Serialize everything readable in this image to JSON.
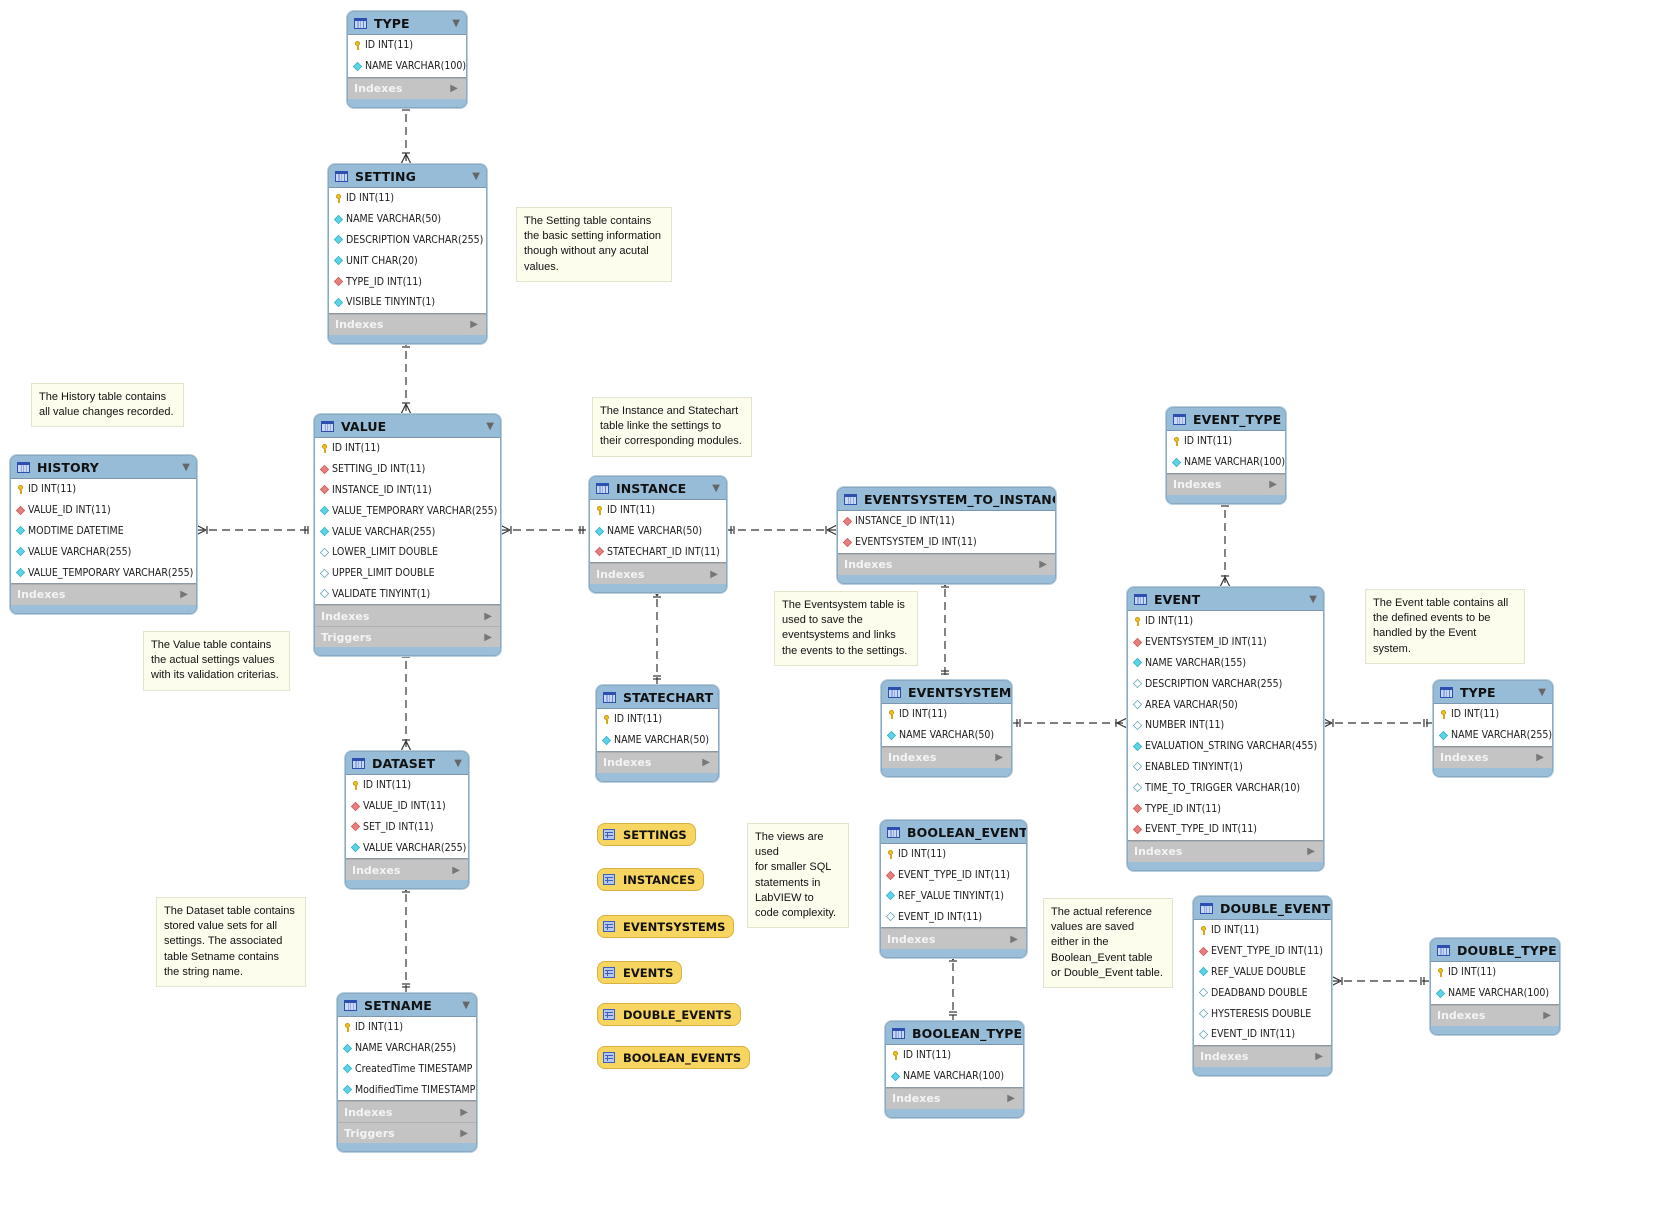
{
  "diagram": {
    "section_labels": {
      "indexes": "Indexes",
      "triggers": "Triggers"
    },
    "tables": [
      {
        "id": "type_top",
        "name": "TYPE",
        "columns": [
          {
            "text": "ID INT(11)",
            "kind": "pk"
          },
          {
            "text": "NAME VARCHAR(100)",
            "kind": "nn"
          }
        ],
        "sections": [
          "indexes"
        ]
      },
      {
        "id": "setting",
        "name": "SETTING",
        "columns": [
          {
            "text": "ID INT(11)",
            "kind": "pk"
          },
          {
            "text": "NAME VARCHAR(50)",
            "kind": "nn"
          },
          {
            "text": "DESCRIPTION VARCHAR(255)",
            "kind": "nn"
          },
          {
            "text": "UNIT CHAR(20)",
            "kind": "nn"
          },
          {
            "text": "TYPE_ID INT(11)",
            "kind": "fk"
          },
          {
            "text": "VISIBLE TINYINT(1)",
            "kind": "nn"
          }
        ],
        "sections": [
          "indexes"
        ]
      },
      {
        "id": "history",
        "name": "HISTORY",
        "columns": [
          {
            "text": "ID INT(11)",
            "kind": "pk"
          },
          {
            "text": "VALUE_ID INT(11)",
            "kind": "fk"
          },
          {
            "text": "MODTIME DATETIME",
            "kind": "nn"
          },
          {
            "text": "VALUE VARCHAR(255)",
            "kind": "nn"
          },
          {
            "text": "VALUE_TEMPORARY VARCHAR(255)",
            "kind": "nn"
          }
        ],
        "sections": [
          "indexes"
        ]
      },
      {
        "id": "value",
        "name": "VALUE",
        "columns": [
          {
            "text": "ID INT(11)",
            "kind": "pk"
          },
          {
            "text": "SETTING_ID INT(11)",
            "kind": "fk"
          },
          {
            "text": "INSTANCE_ID INT(11)",
            "kind": "fk"
          },
          {
            "text": "VALUE_TEMPORARY VARCHAR(255)",
            "kind": "nn"
          },
          {
            "text": "VALUE VARCHAR(255)",
            "kind": "nn"
          },
          {
            "text": "LOWER_LIMIT DOUBLE",
            "kind": "nl"
          },
          {
            "text": "UPPER_LIMIT DOUBLE",
            "kind": "nl"
          },
          {
            "text": "VALIDATE TINYINT(1)",
            "kind": "nl"
          }
        ],
        "sections": [
          "indexes",
          "triggers"
        ]
      },
      {
        "id": "instance",
        "name": "INSTANCE",
        "columns": [
          {
            "text": "ID INT(11)",
            "kind": "pk"
          },
          {
            "text": "NAME VARCHAR(50)",
            "kind": "nn"
          },
          {
            "text": "STATECHART_ID INT(11)",
            "kind": "fk"
          }
        ],
        "sections": [
          "indexes"
        ]
      },
      {
        "id": "es_to_instance",
        "name": "EVENTSYSTEM_TO_INSTANCE",
        "columns": [
          {
            "text": "INSTANCE_ID INT(11)",
            "kind": "fk"
          },
          {
            "text": "EVENTSYSTEM_ID INT(11)",
            "kind": "fk"
          }
        ],
        "sections": [
          "indexes"
        ]
      },
      {
        "id": "event_type",
        "name": "EVENT_TYPE",
        "columns": [
          {
            "text": "ID INT(11)",
            "kind": "pk"
          },
          {
            "text": "NAME VARCHAR(100)",
            "kind": "nn"
          }
        ],
        "sections": [
          "indexes"
        ]
      },
      {
        "id": "statechart",
        "name": "STATECHART",
        "columns": [
          {
            "text": "ID INT(11)",
            "kind": "pk"
          },
          {
            "text": "NAME VARCHAR(50)",
            "kind": "nn"
          }
        ],
        "sections": [
          "indexes"
        ]
      },
      {
        "id": "eventsystem",
        "name": "EVENTSYSTEM",
        "columns": [
          {
            "text": "ID INT(11)",
            "kind": "pk"
          },
          {
            "text": "NAME VARCHAR(50)",
            "kind": "nn"
          }
        ],
        "sections": [
          "indexes"
        ]
      },
      {
        "id": "event",
        "name": "EVENT",
        "columns": [
          {
            "text": "ID INT(11)",
            "kind": "pk"
          },
          {
            "text": "EVENTSYSTEM_ID INT(11)",
            "kind": "fk"
          },
          {
            "text": "NAME VARCHAR(155)",
            "kind": "nn"
          },
          {
            "text": "DESCRIPTION VARCHAR(255)",
            "kind": "nl"
          },
          {
            "text": "AREA VARCHAR(50)",
            "kind": "nl"
          },
          {
            "text": "NUMBER INT(11)",
            "kind": "nl"
          },
          {
            "text": "EVALUATION_STRING VARCHAR(455)",
            "kind": "nn"
          },
          {
            "text": "ENABLED TINYINT(1)",
            "kind": "nl"
          },
          {
            "text": "TIME_TO_TRIGGER VARCHAR(10)",
            "kind": "nl"
          },
          {
            "text": "TYPE_ID INT(11)",
            "kind": "fk"
          },
          {
            "text": "EVENT_TYPE_ID INT(11)",
            "kind": "fk"
          }
        ],
        "sections": [
          "indexes"
        ]
      },
      {
        "id": "type_right",
        "name": "TYPE",
        "columns": [
          {
            "text": "ID INT(11)",
            "kind": "pk"
          },
          {
            "text": "NAME VARCHAR(255)",
            "kind": "nn"
          }
        ],
        "sections": [
          "indexes"
        ]
      },
      {
        "id": "dataset",
        "name": "DATASET",
        "columns": [
          {
            "text": "ID INT(11)",
            "kind": "pk"
          },
          {
            "text": "VALUE_ID INT(11)",
            "kind": "fk"
          },
          {
            "text": "SET_ID INT(11)",
            "kind": "fk"
          },
          {
            "text": "VALUE VARCHAR(255)",
            "kind": "nn"
          }
        ],
        "sections": [
          "indexes"
        ]
      },
      {
        "id": "boolean_event",
        "name": "BOOLEAN_EVENT",
        "columns": [
          {
            "text": "ID INT(11)",
            "kind": "pk"
          },
          {
            "text": "EVENT_TYPE_ID INT(11)",
            "kind": "fk"
          },
          {
            "text": "REF_VALUE TINYINT(1)",
            "kind": "nn"
          },
          {
            "text": "EVENT_ID INT(11)",
            "kind": "nl"
          }
        ],
        "sections": [
          "indexes"
        ]
      },
      {
        "id": "double_event",
        "name": "DOUBLE_EVENT",
        "columns": [
          {
            "text": "ID INT(11)",
            "kind": "pk"
          },
          {
            "text": "EVENT_TYPE_ID INT(11)",
            "kind": "fk"
          },
          {
            "text": "REF_VALUE DOUBLE",
            "kind": "nn"
          },
          {
            "text": "DEADBAND DOUBLE",
            "kind": "nl"
          },
          {
            "text": "HYSTERESIS DOUBLE",
            "kind": "nl"
          },
          {
            "text": "EVENT_ID INT(11)",
            "kind": "nl"
          }
        ],
        "sections": [
          "indexes"
        ]
      },
      {
        "id": "double_type",
        "name": "DOUBLE_TYPE",
        "columns": [
          {
            "text": "ID INT(11)",
            "kind": "pk"
          },
          {
            "text": "NAME VARCHAR(100)",
            "kind": "nn"
          }
        ],
        "sections": [
          "indexes"
        ]
      },
      {
        "id": "setname",
        "name": "SETNAME",
        "columns": [
          {
            "text": "ID INT(11)",
            "kind": "pk"
          },
          {
            "text": "NAME VARCHAR(255)",
            "kind": "nn"
          },
          {
            "text": "CreatedTime TIMESTAMP",
            "kind": "nn"
          },
          {
            "text": "ModifiedTime TIMESTAMP",
            "kind": "nn"
          }
        ],
        "sections": [
          "indexes",
          "triggers"
        ]
      },
      {
        "id": "boolean_type",
        "name": "BOOLEAN_TYPE",
        "columns": [
          {
            "text": "ID INT(11)",
            "kind": "pk"
          },
          {
            "text": "NAME VARCHAR(100)",
            "kind": "nn"
          }
        ],
        "sections": [
          "indexes"
        ]
      }
    ],
    "views": [
      {
        "id": "v_settings",
        "name": "SETTINGS"
      },
      {
        "id": "v_instances",
        "name": "INSTANCES"
      },
      {
        "id": "v_eventsystems",
        "name": "EVENTSYSTEMS"
      },
      {
        "id": "v_events",
        "name": "EVENTS"
      },
      {
        "id": "v_double_events",
        "name": "DOUBLE_EVENTS"
      },
      {
        "id": "v_boolean_events",
        "name": "BOOLEAN_EVENTS"
      }
    ],
    "notes": [
      {
        "id": "n_setting",
        "text": "The Setting table contains\nthe basic setting information\nthough without any acutal\nvalues."
      },
      {
        "id": "n_history",
        "text": "The History table contains\nall value changes recorded."
      },
      {
        "id": "n_instance",
        "text": "The Instance and Statechart\ntable linke the settings to\ntheir corresponding modules."
      },
      {
        "id": "n_value",
        "text": "The Value table contains\nthe actual settings values\nwith its validation criterias."
      },
      {
        "id": "n_eventsystem",
        "text": "The Eventsystem table is\nused to save the\neventsystems and links\nthe events to the settings."
      },
      {
        "id": "n_event",
        "text": "The Event table contains all\nthe defined events to be\nhandled by the Event\n system."
      },
      {
        "id": "n_views",
        "text": "The views are\nused\nfor smaller SQL\nstatements in\nLabVIEW to\ncode complexity."
      },
      {
        "id": "n_dataset",
        "text": "The Dataset table contains\nstored value sets for all\nsettings. The associated\ntable Setname contains\nthe string name."
      },
      {
        "id": "n_reference",
        "text": "The actual reference\nvalues are saved\neither in the\nBoolean_Event table\nor Double_Event table."
      }
    ],
    "relationships": [
      {
        "from": "type_top",
        "to": "setting",
        "cardinality": "one-to-many"
      },
      {
        "from": "setting",
        "to": "value",
        "cardinality": "one-to-many"
      },
      {
        "from": "value",
        "to": "history",
        "cardinality": "one-to-many"
      },
      {
        "from": "instance",
        "to": "value",
        "cardinality": "one-to-many"
      },
      {
        "from": "instance",
        "to": "es_to_instance",
        "cardinality": "one-to-many"
      },
      {
        "from": "statechart",
        "to": "instance",
        "cardinality": "one-to-many"
      },
      {
        "from": "eventsystem",
        "to": "es_to_instance",
        "cardinality": "one-to-many"
      },
      {
        "from": "eventsystem",
        "to": "event",
        "cardinality": "one-to-many"
      },
      {
        "from": "event_type",
        "to": "event",
        "cardinality": "one-to-many"
      },
      {
        "from": "type_right",
        "to": "event",
        "cardinality": "one-to-many"
      },
      {
        "from": "value",
        "to": "dataset",
        "cardinality": "one-to-many"
      },
      {
        "from": "setname",
        "to": "dataset",
        "cardinality": "one-to-many"
      },
      {
        "from": "boolean_type",
        "to": "boolean_event",
        "cardinality": "one-to-many"
      },
      {
        "from": "double_type",
        "to": "double_event",
        "cardinality": "one-to-many"
      }
    ]
  }
}
